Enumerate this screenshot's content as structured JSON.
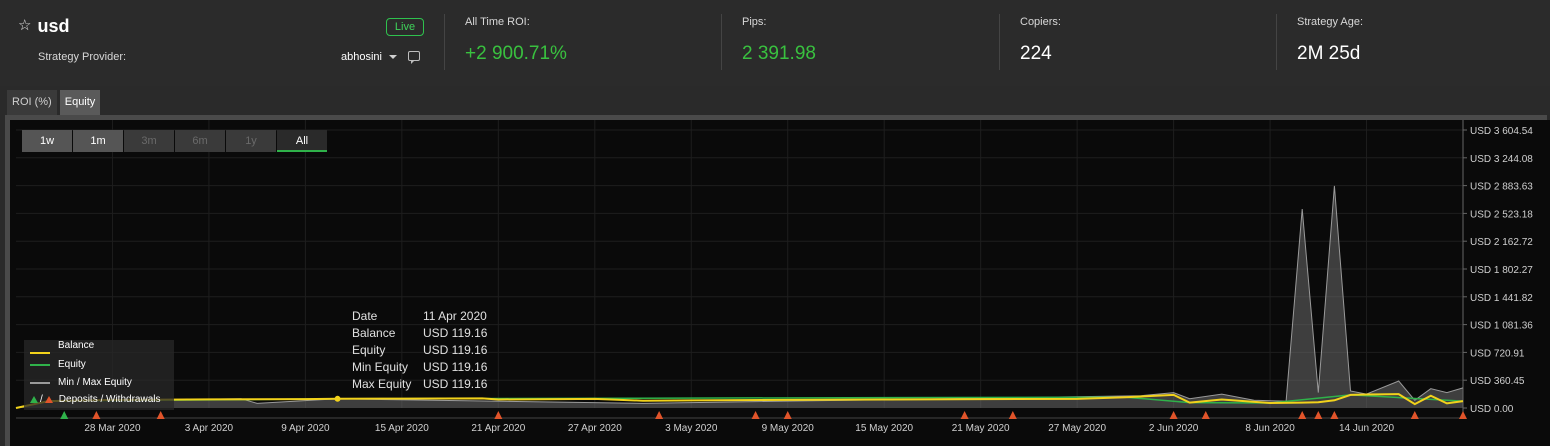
{
  "header": {
    "title": "usd",
    "live_badge": "Live",
    "provider_label": "Strategy Provider:",
    "provider_name": "abhosini",
    "stats": [
      {
        "label": "All Time ROI:",
        "value": "+2 900.71%",
        "color": "#39c13f"
      },
      {
        "label": "Pips:",
        "value": "2 391.98",
        "color": "#39c13f"
      },
      {
        "label": "Copiers:",
        "value": "224",
        "color": "#ffffff"
      },
      {
        "label": "Strategy Age:",
        "value": "2M 25d",
        "color": "#ffffff"
      }
    ]
  },
  "tabs": [
    {
      "label": "ROI (%)",
      "active": false
    },
    {
      "label": "Equity",
      "active": true
    }
  ],
  "range_buttons": [
    {
      "label": "1w",
      "state": "enabled"
    },
    {
      "label": "1m",
      "state": "enabled"
    },
    {
      "label": "3m",
      "state": "disabled"
    },
    {
      "label": "6m",
      "state": "disabled"
    },
    {
      "label": "1y",
      "state": "disabled"
    },
    {
      "label": "All",
      "state": "selected"
    }
  ],
  "tooltip": {
    "rows": [
      {
        "key": "Date",
        "value": "11 Apr 2020"
      },
      {
        "key": "Balance",
        "value": "USD 119.16"
      },
      {
        "key": "Equity",
        "value": "USD 119.16"
      },
      {
        "key": "Min Equity",
        "value": "USD 119.16"
      },
      {
        "key": "Max Equity",
        "value": "USD 119.16"
      }
    ]
  },
  "legend": {
    "balance": "Balance",
    "equity": "Equity",
    "minmax": "Min / Max Equity",
    "separator": "/",
    "deposits": "Deposits / Withdrawals"
  },
  "colors": {
    "balance": "#f2d21b",
    "equity": "#2fb24a",
    "minmax": "#9a9a9a",
    "deposit": "#2fb24a",
    "withdrawal": "#e0542a"
  },
  "chart_data": {
    "type": "area",
    "ylabel": "",
    "y_ticks": [
      "USD 0.00",
      "USD 360.45",
      "USD 720.91",
      "USD 1 081.36",
      "USD 1 441.82",
      "USD 1 802.27",
      "USD 2 162.72",
      "USD 2 523.18",
      "USD 2 883.63",
      "USD 3 244.08",
      "USD 3 604.54"
    ],
    "ylim": [
      0,
      3604.54
    ],
    "x_ticks": [
      "28 Mar 2020",
      "3 Apr 2020",
      "9 Apr 2020",
      "15 Apr 2020",
      "21 Apr 2020",
      "27 Apr 2020",
      "3 May 2020",
      "9 May 2020",
      "15 May 2020",
      "21 May 2020",
      "27 May 2020",
      "2 Jun 2020",
      "8 Jun 2020",
      "14 Jun 2020"
    ],
    "x_start": "2020-03-22",
    "x_end": "2020-06-20",
    "series": [
      {
        "name": "Balance",
        "x": [
          "2020-03-22",
          "2020-03-24",
          "2020-03-28",
          "2020-04-03",
          "2020-04-09",
          "2020-04-11",
          "2020-04-15",
          "2020-04-20",
          "2020-04-21",
          "2020-04-27",
          "2020-04-30",
          "2020-05-03",
          "2020-05-09",
          "2020-05-15",
          "2020-05-21",
          "2020-05-27",
          "2020-05-30",
          "2020-06-02",
          "2020-06-03",
          "2020-06-05",
          "2020-06-08",
          "2020-06-10",
          "2020-06-11",
          "2020-06-12",
          "2020-06-13",
          "2020-06-14",
          "2020-06-16",
          "2020-06-17",
          "2020-06-18",
          "2020-06-19",
          "2020-06-20"
        ],
        "y": [
          0,
          90,
          105,
          112,
          115,
          119.16,
          122,
          125,
          110,
          118,
          95,
          98,
          105,
          110,
          115,
          118,
          140,
          170,
          70,
          110,
          65,
          70,
          75,
          100,
          170,
          175,
          180,
          50,
          160,
          60,
          90
        ]
      },
      {
        "name": "Equity",
        "x": [
          "2020-03-22",
          "2020-03-24",
          "2020-04-11",
          "2020-05-30",
          "2020-06-03",
          "2020-06-08",
          "2020-06-13",
          "2020-06-20"
        ],
        "y": [
          0,
          90,
          119.16,
          140,
          70,
          65,
          170,
          90
        ]
      },
      {
        "name": "Min / Max Equity",
        "x": [
          "2020-03-22",
          "2020-03-24",
          "2020-04-05",
          "2020-04-06",
          "2020-04-11",
          "2020-04-30",
          "2020-05-31",
          "2020-06-02",
          "2020-06-03",
          "2020-06-05",
          "2020-06-07",
          "2020-06-09",
          "2020-06-10",
          "2020-06-11",
          "2020-06-12",
          "2020-06-13",
          "2020-06-14",
          "2020-06-16",
          "2020-06-17",
          "2020-06-18",
          "2020-06-19",
          "2020-06-20"
        ],
        "y": [
          0,
          90,
          120,
          60,
          119.16,
          60,
          160,
          200,
          120,
          180,
          100,
          90,
          2580,
          200,
          2880,
          220,
          180,
          350,
          100,
          250,
          200,
          260
        ]
      }
    ],
    "deposits": [
      "2020-03-25"
    ],
    "withdrawals": [
      "2020-03-27",
      "2020-03-31",
      "2020-04-21",
      "2020-05-01",
      "2020-05-07",
      "2020-05-09",
      "2020-05-20",
      "2020-05-23",
      "2020-06-02",
      "2020-06-04",
      "2020-06-10",
      "2020-06-11",
      "2020-06-12",
      "2020-06-17",
      "2020-06-20"
    ],
    "tooltip_point": {
      "x": "2020-04-11",
      "y": 119.16
    },
    "grid": true,
    "legend_position": "bottom-left"
  }
}
